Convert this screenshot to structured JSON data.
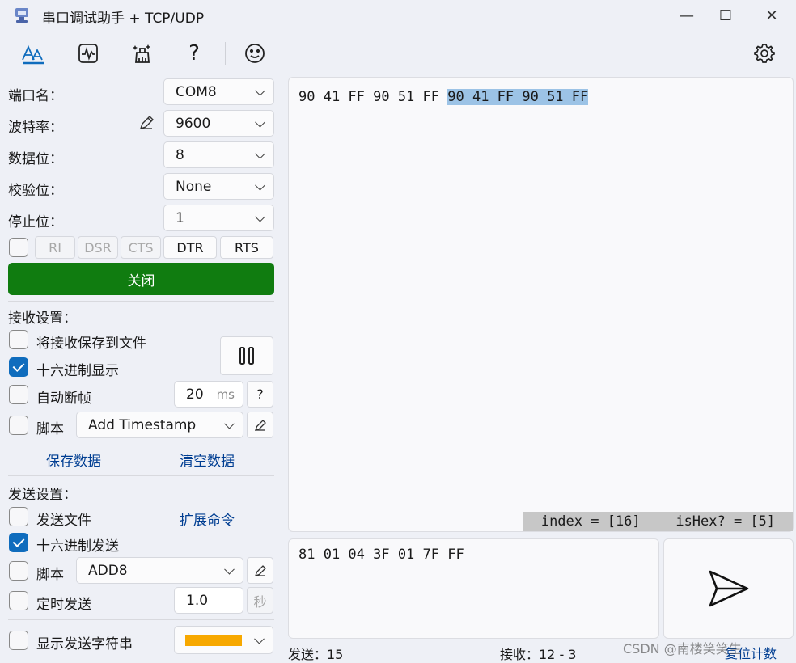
{
  "window": {
    "title": "串口调试助手 + TCP/UDP",
    "min": "—",
    "max": "☐",
    "close": "✕"
  },
  "serial": {
    "port_label": "端口名：",
    "port_value": "COM8",
    "baud_label": "波特率：",
    "baud_value": "9600",
    "databits_label": "数据位：",
    "databits_value": "8",
    "parity_label": "校验位：",
    "parity_value": "None",
    "stopbits_label": "停止位：",
    "stopbits_value": "1",
    "signals": [
      "RI",
      "DSR",
      "CTS",
      "DTR",
      "RTS"
    ],
    "close_button": "关闭",
    "close_button_color": "#107c10"
  },
  "receive": {
    "heading": "接收设置：",
    "save_to_file": "将接收保存到文件",
    "hex_display": "十六进制显示",
    "auto_frame": "自动断帧",
    "frame_value": "20",
    "frame_unit": "ms",
    "help": "?",
    "script": "脚本",
    "script_value": "Add Timestamp",
    "save_data": "保存数据",
    "clear_data": "清空数据"
  },
  "send": {
    "heading": "发送设置：",
    "send_file": "发送文件",
    "extend_cmd": "扩展命令",
    "hex_send": "十六进制发送",
    "script": "脚本",
    "script_value": "ADD8",
    "timed_send": "定时发送",
    "timed_value": "1.0",
    "timed_unit": "秒",
    "show_string": "显示发送字符串",
    "color_swatch": "#f7a800"
  },
  "output": {
    "normal_text": "90 41 FF 90 51 FF",
    "selected_text": "90 41 FF 90 51 FF",
    "selection_color": "#9cc3e6",
    "status_index": "index = [16]",
    "status_ishex": "isHex? = [5]"
  },
  "input": {
    "text": "81 01 04 3F 01 7F FF"
  },
  "footer": {
    "sent_label": "发送：15",
    "recv_label": "接收：12 - 3",
    "reset": "复位计数",
    "watermark": "CSDN @南楼笑笑生"
  }
}
